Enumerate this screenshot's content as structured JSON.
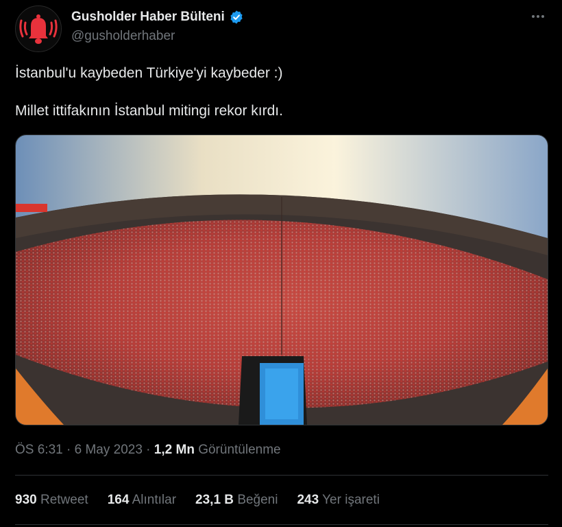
{
  "author": {
    "display_name": "Gusholder Haber Bülteni",
    "handle": "@gusholderhaber",
    "verified": true,
    "avatar_icon": "bell-icon",
    "avatar_color": "#e8323c"
  },
  "tweet": {
    "lines": [
      "İstanbul'u kaybeden Türkiye'yi kaybeder :)",
      "Millet ittifakının İstanbul mitingi rekor kırdı."
    ],
    "media_description_icon": "crowd-photo"
  },
  "meta": {
    "time": "ÖS 6:31",
    "separator": " · ",
    "date": "6 May 2023",
    "views_count": "1,2 Mn",
    "views_label": "Görüntülenme"
  },
  "stats": {
    "retweets": {
      "count": "930",
      "label": "Retweet"
    },
    "quotes": {
      "count": "164",
      "label": "Alıntılar"
    },
    "likes": {
      "count": "23,1 B",
      "label": "Beğeni"
    },
    "bookmarks": {
      "count": "243",
      "label": "Yer işareti"
    }
  },
  "colors": {
    "background": "#000000",
    "text_primary": "#e7e9ea",
    "text_secondary": "#71767b",
    "verified_blue": "#1d9bf0",
    "divider": "#2f3336"
  }
}
